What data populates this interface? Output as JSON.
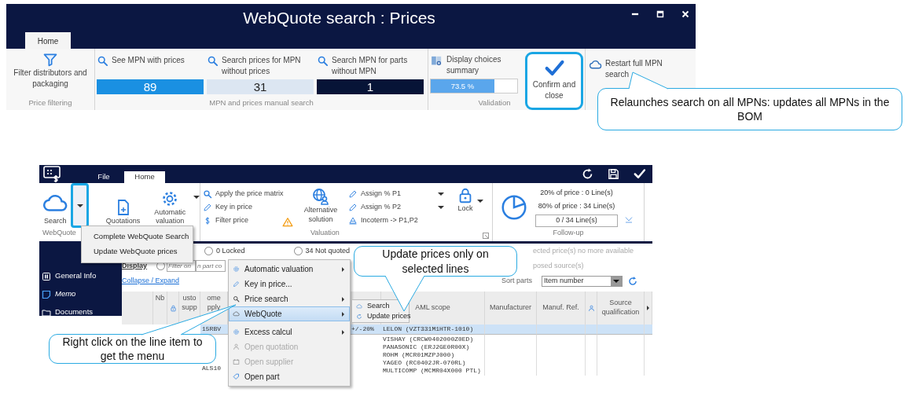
{
  "prices_window": {
    "title": "WebQuote search : Prices",
    "tabs": [
      {
        "label": "Home",
        "selected": true
      }
    ],
    "filter_group": {
      "button": "Filter distributors and packaging",
      "label": "Price filtering"
    },
    "search_group": {
      "label": "MPN and prices manual search",
      "counters": [
        {
          "button": "See MPN with prices",
          "count": "89",
          "color": "#1a90e2"
        },
        {
          "button": "Search prices for MPN without prices",
          "count": "31",
          "color": "#dce6f2"
        },
        {
          "button": "Search MPN for parts without MPN",
          "count": "1",
          "color": "#071437"
        }
      ]
    },
    "validation_group": {
      "label": "Validation",
      "summary": "Display choices summary",
      "progress": {
        "level": 0.735,
        "reading": "73.5 %"
      },
      "confirm": {
        "label": "Confirm and close",
        "highlighted": true
      }
    },
    "restart_button": "Restart full MPN search"
  },
  "main_window": {
    "tabs": [
      {
        "label": "File",
        "selected": false
      },
      {
        "label": "Home",
        "selected": true
      }
    ],
    "webquote_group": {
      "label": "WebQuote",
      "buttons": [
        {
          "label": "Search",
          "dropdown": true,
          "highlighted": true
        },
        {
          "label": "Quotations",
          "dropdown": false
        },
        {
          "label": "Automatic valuation",
          "dropdown": true
        }
      ]
    },
    "search_menu": [
      "Complete WebQuote Search",
      "Update WebQuote prices"
    ],
    "valuation_group": {
      "label": "Valuation",
      "actions": [
        "Apply the price matrix",
        "Key in price",
        "Filter price"
      ],
      "alternative": "Alternative solution",
      "assign": [
        {
          "label": "Assign % P1",
          "dropdown": true
        },
        {
          "label": "Assign % P2",
          "dropdown": true
        },
        {
          "label": "Incoterm -> P1,P2",
          "dropdown": false
        }
      ],
      "lock": "Lock"
    },
    "followup_group": {
      "label": "Follow-up",
      "lines": [
        "20% of price : 0 Line(s)",
        "80% of price : 34 Line(s)"
      ],
      "counter": "0 / 34 Line(s)"
    },
    "sidebar": {
      "items": [
        "General Info",
        "Memo",
        "Documents"
      ]
    },
    "filters": {
      "status": [
        {
          "label": "0 Locked",
          "selected": false
        },
        {
          "label": "34 Not quoted",
          "selected": false
        }
      ],
      "display": "Display",
      "filter_radio": {
        "selected": false
      },
      "filter_placeholder": "Filter on",
      "part_placeholder": "n part co",
      "collapse": "Collapse / Expand",
      "notices": [
        "ected price(s) no more available",
        "posed source(s)"
      ],
      "sort_label": "Sort parts",
      "sort_value": "Item number"
    },
    "table": {
      "columns": [
        {
          "kind": "blank"
        },
        {
          "kind": "text",
          "label": "Nb"
        },
        {
          "kind": "lock"
        },
        {
          "kind": "text",
          "label": "usto supp"
        },
        {
          "kind": "text",
          "label": "ome pply"
        },
        {
          "kind": "blank"
        },
        {
          "kind": "blank"
        },
        {
          "kind": "text",
          "label": "AML scope"
        },
        {
          "kind": "text",
          "label": "Manufacturer"
        },
        {
          "kind": "text",
          "label": "Manuf. Ref."
        },
        {
          "kind": "person"
        },
        {
          "kind": "text",
          "label": "Source qualification"
        },
        {
          "kind": "arrow"
        }
      ],
      "rows": [
        {
          "selected": true,
          "part": "15RBV",
          "tolerance": "+/-20%",
          "aml_scope": [
            "LELON (VZT331M1HTR-1010)"
          ]
        },
        {
          "selected": false,
          "part": "ALS10",
          "aml_scope": [
            "VISHAY (CRCW0402000Z0ED)",
            "PANASONIC (ERJ2GE0R00X)",
            "ROHM (MCR01MZPJ000)",
            "YAGEO (RC0402JR-070RL)",
            "MULTICOMP (MCMR04X000 PTL)"
          ]
        }
      ]
    },
    "context_menu": [
      {
        "label": "Automatic valuation",
        "submenu": true,
        "disabled": false,
        "selected": false
      },
      {
        "label": "Key in price...",
        "submenu": false,
        "disabled": false,
        "selected": false
      },
      {
        "label": "Price search",
        "submenu": true,
        "disabled": false,
        "selected": false
      },
      {
        "label": "WebQuote",
        "submenu": true,
        "disabled": false,
        "selected": true
      },
      {
        "label": "Excess calcul",
        "submenu": true,
        "disabled": false,
        "selected": false
      },
      {
        "label": "Open quotation",
        "submenu": false,
        "disabled": true,
        "selected": false
      },
      {
        "label": "Open supplier",
        "submenu": false,
        "disabled": true,
        "selected": false
      },
      {
        "label": "Open part",
        "submenu": false,
        "disabled": false,
        "selected": false
      }
    ],
    "webquote_submenu": [
      "Search",
      "Update prices"
    ]
  },
  "callouts": [
    {
      "text": "Relaunches search on all MPNs: updates all MPNs in the BOM"
    },
    {
      "text": "Update prices only on selected lines"
    },
    {
      "text": "Right click on the line item to get the menu"
    }
  ]
}
